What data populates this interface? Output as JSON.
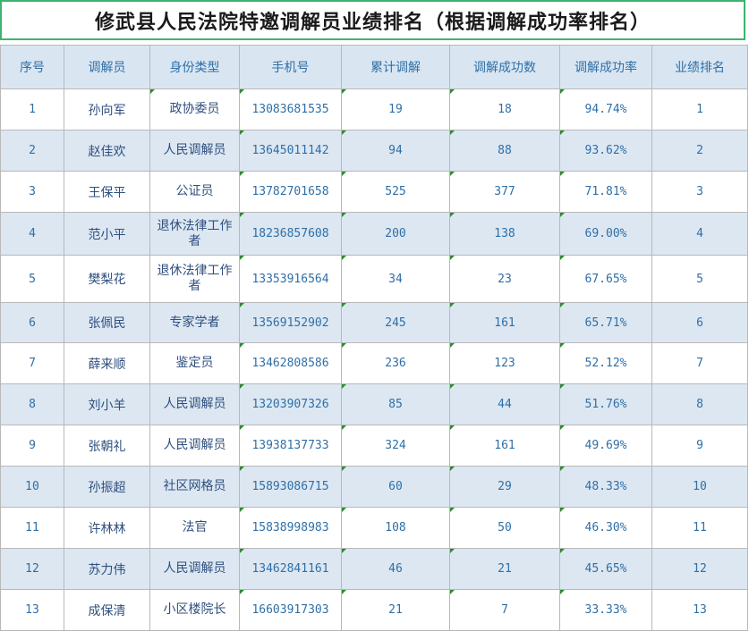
{
  "title": "修武县人民法院特邀调解员业绩排名（根据调解成功率排名）",
  "columns": [
    "序号",
    "调解员",
    "身份类型",
    "手机号",
    "累计调解",
    "调解成功数",
    "调解成功率",
    "业绩排名"
  ],
  "rows": [
    {
      "no": "1",
      "name": "孙向军",
      "type": "政协委员",
      "phone": "13083681535",
      "total": "19",
      "success": "18",
      "rate": "94.74%",
      "rank": "1"
    },
    {
      "no": "2",
      "name": "赵佳欢",
      "type": "人民调解员",
      "phone": "13645011142",
      "total": "94",
      "success": "88",
      "rate": "93.62%",
      "rank": "2"
    },
    {
      "no": "3",
      "name": "王保平",
      "type": "公证员",
      "phone": "13782701658",
      "total": "525",
      "success": "377",
      "rate": "71.81%",
      "rank": "3"
    },
    {
      "no": "4",
      "name": "范小平",
      "type": "退休法律工作者",
      "phone": "18236857608",
      "total": "200",
      "success": "138",
      "rate": "69.00%",
      "rank": "4"
    },
    {
      "no": "5",
      "name": "樊梨花",
      "type": "退休法律工作者",
      "phone": "13353916564",
      "total": "34",
      "success": "23",
      "rate": "67.65%",
      "rank": "5"
    },
    {
      "no": "6",
      "name": "张佩民",
      "type": "专家学者",
      "phone": "13569152902",
      "total": "245",
      "success": "161",
      "rate": "65.71%",
      "rank": "6"
    },
    {
      "no": "7",
      "name": "薛来顺",
      "type": "鉴定员",
      "phone": "13462808586",
      "total": "236",
      "success": "123",
      "rate": "52.12%",
      "rank": "7"
    },
    {
      "no": "8",
      "name": "刘小羊",
      "type": "人民调解员",
      "phone": "13203907326",
      "total": "85",
      "success": "44",
      "rate": "51.76%",
      "rank": "8"
    },
    {
      "no": "9",
      "name": "张朝礼",
      "type": "人民调解员",
      "phone": "13938137733",
      "total": "324",
      "success": "161",
      "rate": "49.69%",
      "rank": "9"
    },
    {
      "no": "10",
      "name": "孙振超",
      "type": "社区网格员",
      "phone": "15893086715",
      "total": "60",
      "success": "29",
      "rate": "48.33%",
      "rank": "10"
    },
    {
      "no": "11",
      "name": "许林林",
      "type": "法官",
      "phone": "15838998983",
      "total": "108",
      "success": "50",
      "rate": "46.30%",
      "rank": "11"
    },
    {
      "no": "12",
      "name": "苏力伟",
      "type": "人民调解员",
      "phone": "13462841161",
      "total": "46",
      "success": "21",
      "rate": "45.65%",
      "rank": "12"
    },
    {
      "no": "13",
      "name": "成保清",
      "type": "小区楼院长",
      "phone": "16603917303",
      "total": "21",
      "success": "7",
      "rate": "33.33%",
      "rank": "13"
    }
  ]
}
